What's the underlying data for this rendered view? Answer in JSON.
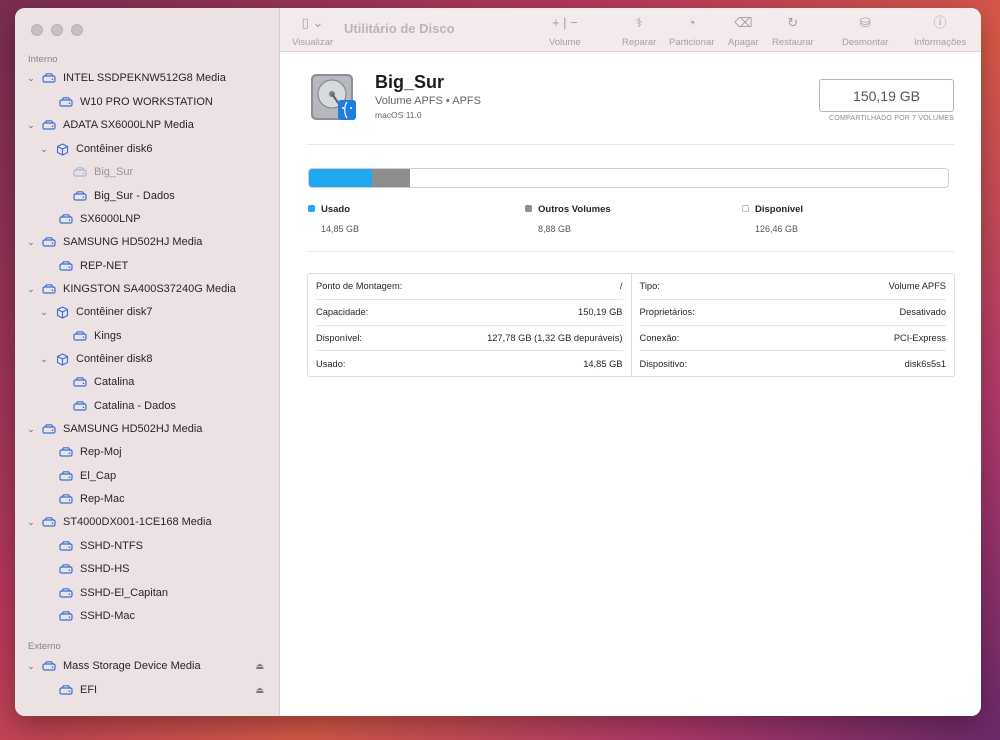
{
  "app": {
    "title": "Utilitário de Disco"
  },
  "toolbar": {
    "view_label": "Visualizar",
    "volume_label": "Volume",
    "firstaid_label": "Reparar",
    "partition_label": "Particionar",
    "erase_label": "Apagar",
    "restore_label": "Restaurar",
    "unmount_label": "Desmontar",
    "info_label": "Informações"
  },
  "sidebar": {
    "internal_title": "Interno",
    "external_title": "Externo",
    "items": [
      {
        "label": "INTEL SSDPEKNW512G8 Media"
      },
      {
        "label": "W10 PRO WORKSTATION"
      },
      {
        "label": "ADATA SX6000LNP Media"
      },
      {
        "label": "Contêiner disk6"
      },
      {
        "label": "Big_Sur"
      },
      {
        "label": "Big_Sur - Dados"
      },
      {
        "label": "SX6000LNP"
      },
      {
        "label": "SAMSUNG HD502HJ Media"
      },
      {
        "label": "REP-NET"
      },
      {
        "label": "KINGSTON SA400S37240G Media"
      },
      {
        "label": "Contêiner disk7"
      },
      {
        "label": "Kings"
      },
      {
        "label": "Contêiner disk8"
      },
      {
        "label": "Catalina"
      },
      {
        "label": "Catalina - Dados"
      },
      {
        "label": "SAMSUNG HD502HJ Media"
      },
      {
        "label": "Rep-Moj"
      },
      {
        "label": "El_Cap"
      },
      {
        "label": "Rep-Mac"
      },
      {
        "label": "ST4000DX001-1CE168 Media"
      },
      {
        "label": "SSHD-NTFS"
      },
      {
        "label": "SSHD-HS"
      },
      {
        "label": "SSHD-El_Capitan"
      },
      {
        "label": "SSHD-Mac"
      },
      {
        "label": "Mass Storage Device Media"
      },
      {
        "label": "EFI"
      }
    ]
  },
  "volume": {
    "name": "Big_Sur",
    "subtitle": "Volume APFS • APFS",
    "os": "macOS 11.0",
    "size": "150,19 GB",
    "shared_note": "COMPARTILHADO POR 7 VOLUMES"
  },
  "usage": {
    "used_fraction": 0.099,
    "other_fraction": 0.059,
    "colors": {
      "used": "#1fa8ef",
      "other": "#8e8e8e",
      "free": "#ffffff"
    },
    "legend": [
      {
        "name": "Usado",
        "value": "14,85 GB"
      },
      {
        "name": "Outros Volumes",
        "value": "8,88 GB"
      },
      {
        "name": "Disponível",
        "value": "126,46 GB"
      }
    ]
  },
  "info": {
    "left": [
      {
        "key": "Ponto de Montagem:",
        "value": "/"
      },
      {
        "key": "Capacidade:",
        "value": "150,19 GB"
      },
      {
        "key": "Disponível:",
        "value": "127,78 GB (1,32 GB depuráveis)"
      },
      {
        "key": "Usado:",
        "value": "14,85 GB"
      }
    ],
    "right": [
      {
        "key": "Tipo:",
        "value": "Volume APFS"
      },
      {
        "key": "Proprietários:",
        "value": "Desativado"
      },
      {
        "key": "Conexão:",
        "value": "PCI-Express"
      },
      {
        "key": "Dispositivo:",
        "value": "disk6s5s1"
      }
    ]
  }
}
